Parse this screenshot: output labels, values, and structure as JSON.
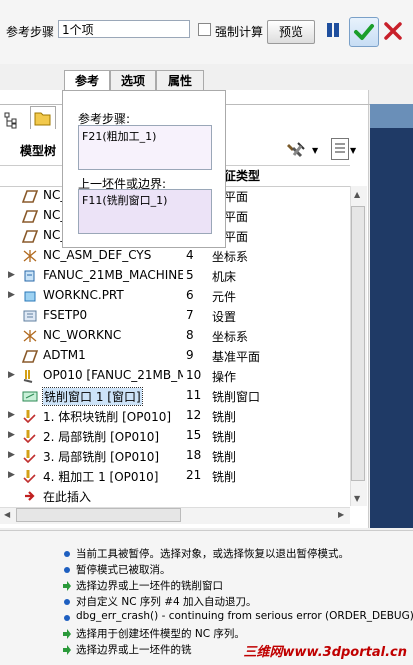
{
  "dashboard": {
    "step_label": "参考步骤",
    "step_value": "1个项",
    "force_label": "强制计算",
    "preview_label": "预览"
  },
  "tabs": [
    "参考",
    "选项",
    "属性"
  ],
  "popup": {
    "ref_step_label": "参考步骤:",
    "ref_step_value": "F21(粗加工_1)",
    "prev_label": "上一坯件或边界:",
    "prev_value": "F11(铣削窗口_1)"
  },
  "tree": {
    "title": "模型树",
    "col_feature_type": "特征类型",
    "rows": [
      {
        "name": "NC_",
        "id": "",
        "type": "准平面",
        "icon": "plane-icon",
        "expand": ""
      },
      {
        "name": "NC_",
        "id": "",
        "type": "准平面",
        "icon": "plane-icon",
        "expand": ""
      },
      {
        "name": "NC_",
        "id": "",
        "type": "准平面",
        "icon": "plane-icon",
        "expand": ""
      },
      {
        "name": "NC_ASM_DEF_CYS",
        "id": "4",
        "type": "坐标系",
        "icon": "csys-icon",
        "expand": ""
      },
      {
        "name": "FANUC_21MB_MACHINE",
        "id": "5",
        "type": "机床",
        "icon": "machine-icon",
        "expand": "▶"
      },
      {
        "name": "WORKNC.PRT",
        "id": "6",
        "type": "元件",
        "icon": "part-icon",
        "expand": "▶"
      },
      {
        "name": "FSETP0",
        "id": "7",
        "type": "设置",
        "icon": "setup-icon",
        "expand": ""
      },
      {
        "name": "NC_WORKNC",
        "id": "8",
        "type": "坐标系",
        "icon": "csys-icon",
        "expand": ""
      },
      {
        "name": "ADTM1",
        "id": "9",
        "type": "基准平面",
        "icon": "plane-icon",
        "expand": ""
      },
      {
        "name": "OP010 [FANUC_21MB_M",
        "id": "10",
        "type": "操作",
        "icon": "operation-icon",
        "expand": "▶"
      },
      {
        "name": "铣削窗口 1 [窗口]",
        "id": "11",
        "type": "铣削窗口",
        "icon": "mill-window-icon",
        "expand": ""
      },
      {
        "name": "1. 体积块铣削 [OP010]",
        "id": "12",
        "type": "铣削",
        "icon": "mill-sequence-icon",
        "expand": "▶"
      },
      {
        "name": "2. 局部铣削 [OP010]",
        "id": "15",
        "type": "铣削",
        "icon": "mill-sequence-icon",
        "expand": "▶"
      },
      {
        "name": "3. 局部铣削 [OP010]",
        "id": "18",
        "type": "铣削",
        "icon": "mill-sequence-icon",
        "expand": "▶"
      },
      {
        "name": "4. 粗加工 1 [OP010]",
        "id": "21",
        "type": "铣削",
        "icon": "mill-sequence-icon",
        "expand": "▶"
      },
      {
        "name": "在此插入",
        "id": "",
        "type": "",
        "icon": "insert-here-icon",
        "expand": ""
      }
    ]
  },
  "messages": [
    {
      "kind": "info",
      "text": "当前工具被暂停。选择对象，或选择恢复以退出暂停模式。"
    },
    {
      "kind": "info",
      "text": "暂停模式已被取消。"
    },
    {
      "kind": "prompt",
      "text": "选择边界或上一坯件的铣削窗口"
    },
    {
      "kind": "info",
      "text": "对自定义 NC 序列 #4 加入自动退刀。"
    },
    {
      "kind": "info",
      "text": "dbg_err_crash() - continuing from serious error (ORDER_DEBUG)"
    },
    {
      "kind": "prompt",
      "text": "选择用于创建坯件模型的 NC 序列。"
    },
    {
      "kind": "prompt",
      "text": "选择边界或上一坯件的铣"
    }
  ],
  "watermark": "三维网www.3dportal.cn",
  "colors": {
    "accent": "#1f4f9e",
    "ok_green": "#1a9e2a",
    "cancel_red": "#c8202a",
    "watermark": "#c00000"
  }
}
